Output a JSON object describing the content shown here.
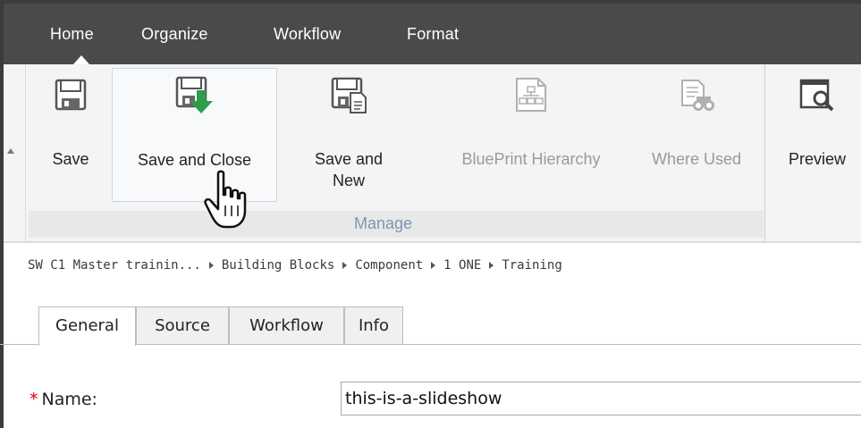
{
  "top_tabs": [
    "Home",
    "Organize",
    "Workflow",
    "Format"
  ],
  "ribbon": {
    "buttons": [
      {
        "label": "Save",
        "icon": "floppy-disk-icon",
        "enabled": true
      },
      {
        "label": "Save and Close",
        "icon": "floppy-disk-arrow-icon",
        "enabled": true
      },
      {
        "label": "Save and New",
        "label_lines": [
          "Save and",
          "New"
        ],
        "icon": "floppy-disk-document-icon",
        "enabled": true
      },
      {
        "label": "BluePrint Hierarchy",
        "icon": "blueprint-hierarchy-icon",
        "enabled": false
      },
      {
        "label": "Where Used",
        "icon": "where-used-binoculars-icon",
        "enabled": false
      },
      {
        "label": "Preview",
        "icon": "preview-magnifier-icon",
        "enabled": true
      }
    ],
    "group_label": "Manage"
  },
  "breadcrumb": [
    "SW C1 Master trainin...",
    "Building Blocks",
    "Component",
    "1 ONE",
    "Training"
  ],
  "form_tabs": [
    "General",
    "Source",
    "Workflow",
    "Info"
  ],
  "active_form_tab": "General",
  "name_field": {
    "required_marker": "*",
    "label": "Name:",
    "value": "this-is-a-slideshow"
  },
  "colors": {
    "tabbar_bg": "#4a4a4a",
    "ribbon_bg": "#f4f4f4",
    "group_label": "#7f96b4",
    "required": "#d0021b",
    "save_close_arrow": "#2e9e4a"
  }
}
